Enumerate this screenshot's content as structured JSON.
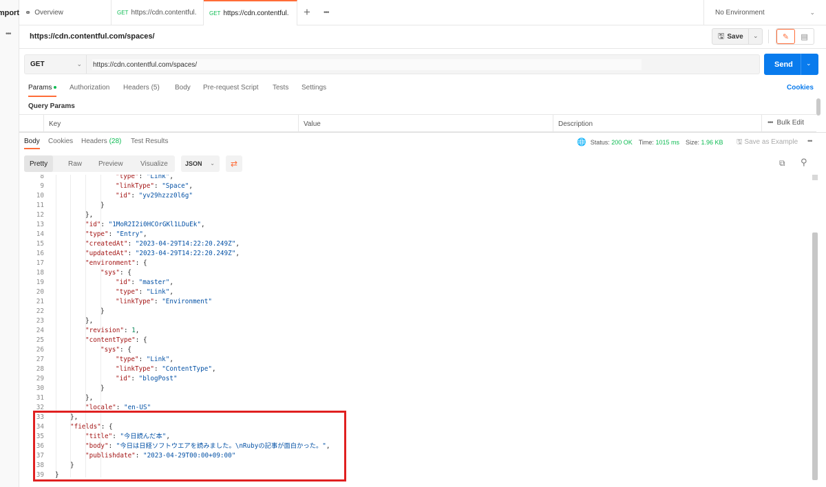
{
  "sidebar": {
    "import_label": "Import",
    "more": "•••"
  },
  "tabs": {
    "overview": "Overview",
    "items": [
      {
        "method": "GET",
        "label": "https://cdn.contentful."
      },
      {
        "method": "GET",
        "label": "https://cdn.contentful."
      }
    ],
    "add": "+",
    "more": "•••"
  },
  "environment": {
    "label": "No Environment"
  },
  "request": {
    "title": "https://cdn.contentful.com/spaces/",
    "method": "GET",
    "url": "https://cdn.contentful.com/spaces/",
    "save_label": "Save",
    "send_label": "Send"
  },
  "request_tabs": [
    {
      "label": "Params"
    },
    {
      "label": "Authorization"
    },
    {
      "label": "Headers (5)"
    },
    {
      "label": "Body"
    },
    {
      "label": "Pre-request Script"
    },
    {
      "label": "Tests"
    },
    {
      "label": "Settings"
    }
  ],
  "cookies_link": "Cookies",
  "query_params": {
    "title": "Query Params",
    "columns": [
      "Key",
      "Value",
      "Description"
    ],
    "bulk_edit": "Bulk Edit",
    "more": "•••"
  },
  "response": {
    "tabs": {
      "body": "Body",
      "cookies": "Cookies",
      "headers": "Headers",
      "headers_count": "(28)",
      "tests": "Test Results"
    },
    "status_label": "Status:",
    "status_value": "200 OK",
    "time_label": "Time:",
    "time_value": "1015 ms",
    "size_label": "Size:",
    "size_value": "1.96 KB",
    "save_example": "Save as Example",
    "more": "•••",
    "views": [
      "Pretty",
      "Raw",
      "Preview",
      "Visualize"
    ],
    "format": "JSON"
  },
  "code": {
    "lines": [
      {
        "n": "8",
        "indent": 3,
        "text": "\"type\": \"Link\","
      },
      {
        "n": "9",
        "indent": 3,
        "text": "\"linkType\": \"Space\","
      },
      {
        "n": "10",
        "indent": 3,
        "text": "\"id\": \"yv29hzzz0l6g\""
      },
      {
        "n": "11",
        "indent": 2,
        "text": "}"
      },
      {
        "n": "12",
        "indent": 1,
        "text": "},"
      },
      {
        "n": "13",
        "indent": 1,
        "text": "\"id\": \"1MoR2I2i0HCOrGKl1LDuEk\","
      },
      {
        "n": "14",
        "indent": 1,
        "text": "\"type\": \"Entry\","
      },
      {
        "n": "15",
        "indent": 1,
        "text": "\"createdAt\": \"2023-04-29T14:22:20.249Z\","
      },
      {
        "n": "16",
        "indent": 1,
        "text": "\"updatedAt\": \"2023-04-29T14:22:20.249Z\","
      },
      {
        "n": "17",
        "indent": 1,
        "text": "\"environment\": {"
      },
      {
        "n": "18",
        "indent": 2,
        "text": "\"sys\": {"
      },
      {
        "n": "19",
        "indent": 3,
        "text": "\"id\": \"master\","
      },
      {
        "n": "20",
        "indent": 3,
        "text": "\"type\": \"Link\","
      },
      {
        "n": "21",
        "indent": 3,
        "text": "\"linkType\": \"Environment\""
      },
      {
        "n": "22",
        "indent": 2,
        "text": "}"
      },
      {
        "n": "23",
        "indent": 1,
        "text": "},"
      },
      {
        "n": "24",
        "indent": 1,
        "text": "\"revision\": 1,"
      },
      {
        "n": "25",
        "indent": 1,
        "text": "\"contentType\": {"
      },
      {
        "n": "26",
        "indent": 2,
        "text": "\"sys\": {"
      },
      {
        "n": "27",
        "indent": 3,
        "text": "\"type\": \"Link\","
      },
      {
        "n": "28",
        "indent": 3,
        "text": "\"linkType\": \"ContentType\","
      },
      {
        "n": "29",
        "indent": 3,
        "text": "\"id\": \"blogPost\""
      },
      {
        "n": "30",
        "indent": 2,
        "text": "}"
      },
      {
        "n": "31",
        "indent": 1,
        "text": "},"
      },
      {
        "n": "32",
        "indent": 1,
        "text": "\"locale\": \"en-US\""
      },
      {
        "n": "33",
        "indent": 0,
        "text": "},"
      },
      {
        "n": "34",
        "indent": 0,
        "text": "\"fields\": {"
      },
      {
        "n": "35",
        "indent": 1,
        "text": "\"title\": \"今日読んだ本\","
      },
      {
        "n": "36",
        "indent": 1,
        "text": "\"body\": \"今日は日経ソフトウエアを読みました。\\nRubyの記事が面白かった。\","
      },
      {
        "n": "37",
        "indent": 1,
        "text": "\"publishdate\": \"2023-04-29T00:00+09:00\""
      },
      {
        "n": "38",
        "indent": 0,
        "text": "}"
      },
      {
        "n": "39",
        "indent": -1,
        "text": "}"
      }
    ]
  },
  "colors": {
    "accent": "#ff6c37",
    "send": "#097bed",
    "ok": "#0cbb52",
    "highlight": "#e02020"
  }
}
